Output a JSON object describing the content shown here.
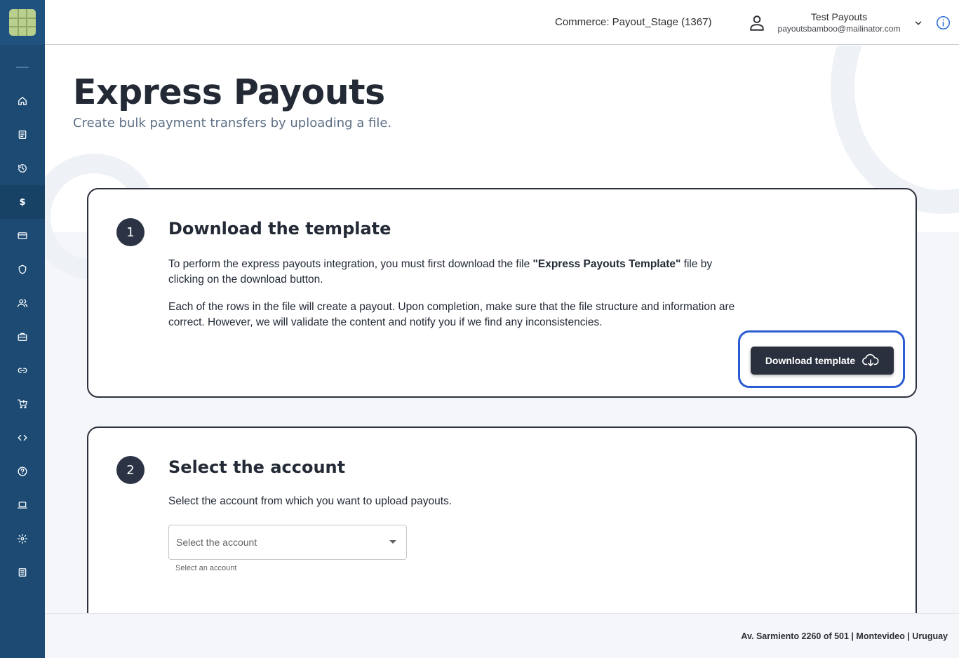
{
  "topbar": {
    "commerce": "Commerce: Payout_Stage (1367)",
    "user_name": "Test Payouts",
    "user_email": "payoutsbamboo@mailinator.com",
    "user_icon": "user-icon",
    "dropdown_icon": "chevron-down-icon",
    "info_icon": "info-icon"
  },
  "sidebar": {
    "logo": "app-logo",
    "items": [
      {
        "icon": "home-icon"
      },
      {
        "icon": "receipt-icon"
      },
      {
        "icon": "history-icon"
      },
      {
        "icon": "dollar-icon",
        "label": "$",
        "active": true
      },
      {
        "icon": "credit-card-icon"
      },
      {
        "icon": "shield-icon"
      },
      {
        "icon": "users-icon"
      },
      {
        "icon": "briefcase-icon"
      },
      {
        "icon": "link-icon"
      },
      {
        "icon": "cart-icon"
      },
      {
        "icon": "code-icon"
      },
      {
        "icon": "help-icon"
      },
      {
        "icon": "laptop-icon"
      },
      {
        "icon": "gear-icon"
      },
      {
        "icon": "list-icon"
      }
    ]
  },
  "page": {
    "title": "Express Payouts",
    "subtitle": "Create bulk payment transfers by uploading a file."
  },
  "step1": {
    "number": "1",
    "title": "Download the template",
    "para1_before": "To perform the express payouts integration, you must first download the file ",
    "para1_bold": "\"Express Payouts Template\"",
    "para1_after": " file by clicking on the download button.",
    "para2": "Each of the rows in the file will create a payout. Upon completion, make sure that the file structure and information are correct. However, we will validate the content and notify you if we find any inconsistencies.",
    "button_label": "Download template",
    "button_icon": "cloud-download-icon"
  },
  "step2": {
    "number": "2",
    "title": "Select the account",
    "description": "Select the account from which you want to upload payouts.",
    "select_placeholder": "Select the account",
    "select_hint": "Select an account"
  },
  "footer": {
    "address": "Av. Sarmiento 2260 of 501 | Montevideo | Uruguay"
  },
  "colors": {
    "sidebar": "#1c4a73",
    "button": "#2a303d",
    "focus_ring": "#2b5cd1"
  }
}
